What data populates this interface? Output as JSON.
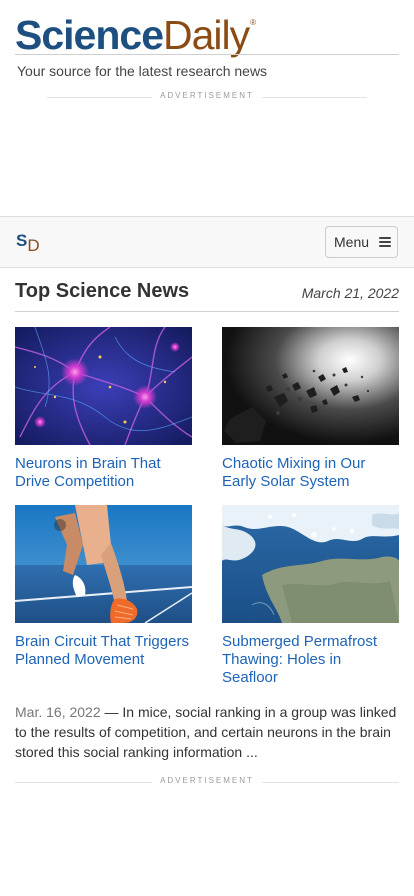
{
  "header": {
    "logo_part1": "Science",
    "logo_part2": "Daily",
    "logo_mark": "®",
    "tagline": "Your source for the latest research news"
  },
  "ads": {
    "label_top": "ADVERTISEMENT",
    "label_bottom": "ADVERTISEMENT"
  },
  "navbar": {
    "brand_s": "S",
    "brand_d": "D",
    "menu_label": "Menu",
    "menu_icon": "hamburger-icon"
  },
  "section": {
    "title": "Top Science News",
    "date": "March 21, 2022"
  },
  "stories": [
    {
      "title": "Neurons in Brain That Drive Competition",
      "image": "neurons-illustration"
    },
    {
      "title": "Chaotic Mixing in Our Early Solar System",
      "image": "asteroid-debris"
    },
    {
      "title": "Brain Circuit That Triggers Planned Movement",
      "image": "sprinter-starting-block"
    },
    {
      "title": "Submerged Permafrost Thawing: Holes in Seafloor",
      "image": "arctic-coastline-satellite"
    }
  ],
  "summary": {
    "date": "Mar. 16, 2022",
    "separator": " — ",
    "text": "In mice, social ranking in a group was linked to the results of competition, and certain neurons in the brain stored this social ranking information ..."
  },
  "colors": {
    "brand_blue": "#1d4f80",
    "brand_brown": "#8a4b14",
    "link_blue": "#1d63b8"
  }
}
